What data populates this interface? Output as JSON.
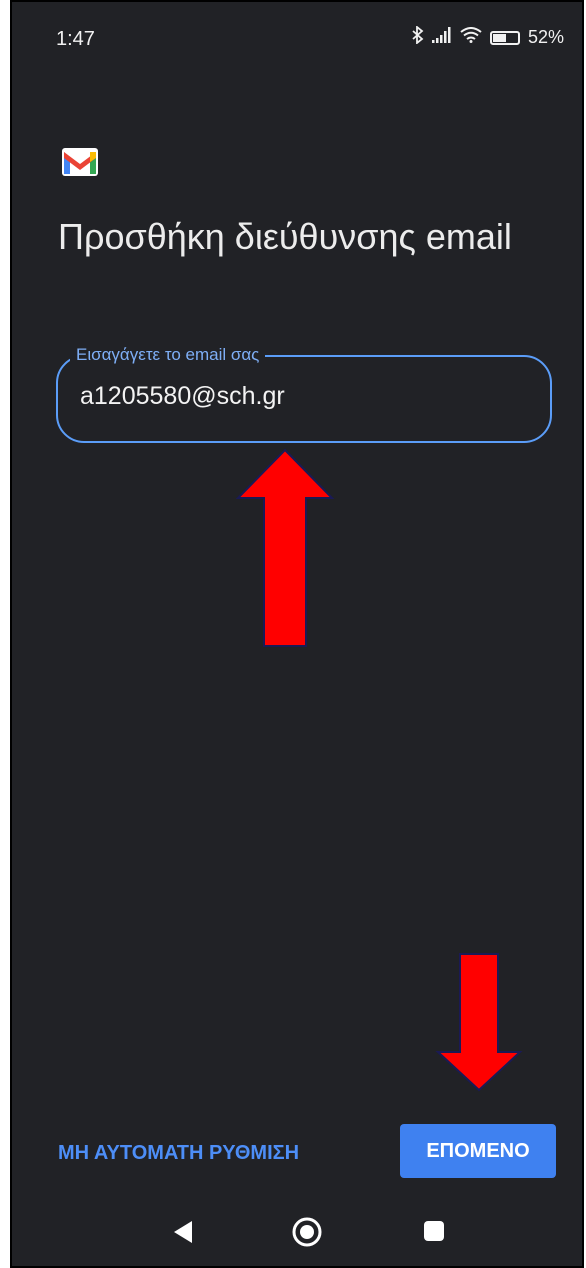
{
  "status_bar": {
    "time": "1:47",
    "battery": "52%",
    "battery_level": 0.52,
    "icons": [
      "bluetooth-icon",
      "signal-icon",
      "wifi-icon",
      "battery-icon"
    ]
  },
  "app": {
    "logo": "gmail-logo-icon"
  },
  "header": {
    "title": "Προσθήκη διεύθυνσης email"
  },
  "email_field": {
    "label": "Εισαγάγετε το email σας",
    "value": "a1205580@sch.gr"
  },
  "actions": {
    "manual_setup_label": "ΜΗ ΑΥΤΟΜΑΤΗ ΡΥΘΜΙΣΗ",
    "next_label": "ΕΠΟΜΕΝΟ"
  },
  "annotations": {
    "arrow_color": "#ff0000"
  },
  "colors": {
    "background": "#212226",
    "accent": "#3f81f0",
    "field_border": "#5b9df8"
  },
  "nav": {
    "icons": [
      "back-icon",
      "home-icon",
      "recents-icon"
    ]
  }
}
